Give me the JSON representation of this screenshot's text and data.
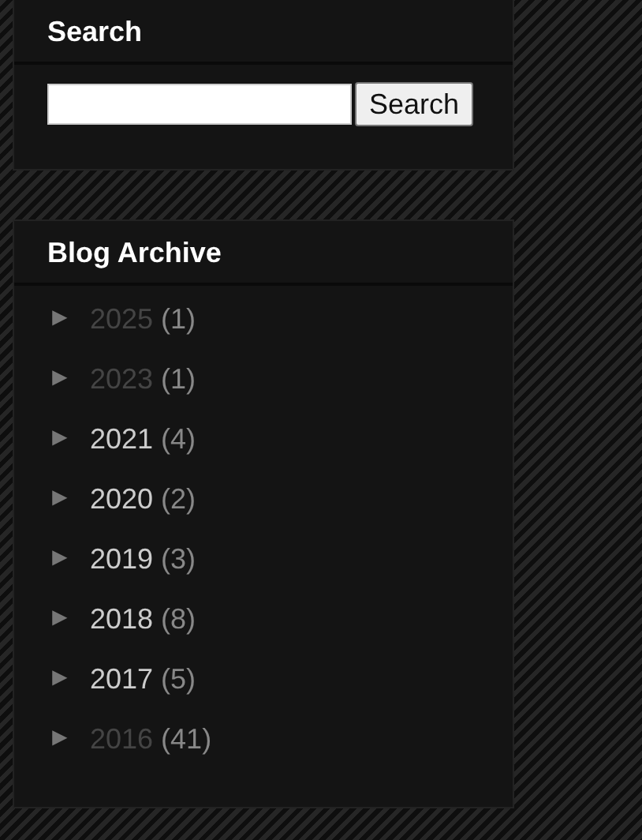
{
  "search_widget": {
    "title": "Search",
    "button": "Search"
  },
  "archive_widget": {
    "title": "Blog Archive",
    "items": [
      {
        "toggle": "►",
        "year": "2025",
        "count": "(1)",
        "visited": true
      },
      {
        "toggle": "►",
        "year": "2023",
        "count": "(1)",
        "visited": true
      },
      {
        "toggle": "►",
        "year": "2021",
        "count": "(4)",
        "visited": false
      },
      {
        "toggle": "►",
        "year": "2020",
        "count": "(2)",
        "visited": false
      },
      {
        "toggle": "►",
        "year": "2019",
        "count": "(3)",
        "visited": false
      },
      {
        "toggle": "►",
        "year": "2018",
        "count": "(8)",
        "visited": false
      },
      {
        "toggle": "►",
        "year": "2017",
        "count": "(5)",
        "visited": false
      },
      {
        "toggle": "►",
        "year": "2016",
        "count": "(41)",
        "visited": true
      }
    ]
  }
}
